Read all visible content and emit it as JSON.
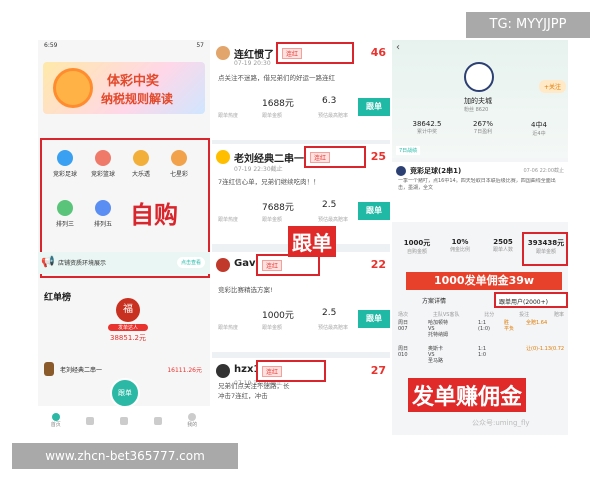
{
  "watermark_tg": "TG: MYYJJPP",
  "watermark_site": "www.zhcn-bet365777.com",
  "left": {
    "time": "6:59",
    "battery": "57",
    "banner_line1": "体彩中奖",
    "banner_line2": "纳税规则解读",
    "categories": [
      {
        "label": "竞彩足球",
        "color": "#3aa0f2"
      },
      {
        "label": "竞彩篮球",
        "color": "#f07a6a"
      },
      {
        "label": "大乐透",
        "color": "#f2b03a"
      },
      {
        "label": "七星彩",
        "color": "#f2a24a"
      },
      {
        "label": "排列三",
        "color": "#5ac47a"
      },
      {
        "label": "排列五",
        "color": "#5a8ef2"
      }
    ],
    "self_buy_caption": "自购",
    "shop_line": "店铺资质环境展示",
    "shop_button": "点击查看",
    "ranking_title": "红单榜",
    "rank_badge": "福",
    "rank_tag": "发单达人",
    "rank_amount": "38851.2元",
    "row_name": "老刘经典二串一",
    "row_amount": "16111.26元",
    "fab": "跟单",
    "nav": [
      "首页",
      "",
      "",
      "",
      "我的"
    ]
  },
  "middle": {
    "posts": [
      {
        "title": "连红惯了",
        "tag": "连红",
        "date": "07-19 20:30",
        "text": "点关注不迷路，借兄弟们的好运一路连红",
        "amount": "1688元",
        "amount_label": "跟单金额",
        "odds": "6.3",
        "odds_label": "预估最高赔率",
        "heat": "跟单热度",
        "follow": "跟单",
        "right_num": "46"
      },
      {
        "title": "老刘经典二串一",
        "tag": "连红",
        "date": "07-19 22:30截止",
        "text": "7连红信心单，兄弟们继续吃肉！！",
        "amount": "7688元",
        "amount_label": "跟单金额",
        "odds": "2.5",
        "odds_label": "预估最高赔率",
        "heat": "跟单热度",
        "follow": "跟单",
        "right_num": "25"
      },
      {
        "title": "Gaven",
        "tag": "连红",
        "date": "",
        "text": "竞彩比赛精选方案!",
        "amount": "1000元",
        "amount_label": "跟单金额",
        "odds": "2.5",
        "odds_label": "预估最高赔率",
        "heat": "跟单热度",
        "follow": "跟单",
        "right_num": "22"
      },
      {
        "title": "hzx123",
        "tag": "连红",
        "date": "07-19 22:30截止",
        "text": "冲击7连红，冲击",
        "amount": "",
        "amount_label": "",
        "odds": "",
        "odds_label": "",
        "heat": "",
        "follow": "",
        "right_num": "27"
      }
    ],
    "intro_line": "兄弟们点关注不迷路，长",
    "follow_caption": "跟单"
  },
  "right": {
    "club": "加的夫城",
    "fans": "粉丝 8620",
    "follow_btn": "+关注",
    "stats": [
      {
        "v": "38642.5",
        "l": "累计中奖"
      },
      {
        "v": "267%",
        "l": "7日盈利"
      },
      {
        "v": "4中4",
        "l": "近4中"
      }
    ],
    "tab": "7日战绩",
    "plan_title": "竞彩足球(2串1)",
    "plan_date": "07-06 22:00截止",
    "plan_text": "一季一个赌叮，点16中14。四天轻取日本联后级比赛，四国曲线全面出击，墨湖，全文",
    "numbers": [
      {
        "v": "1000元",
        "l": "自购金额"
      },
      {
        "v": "10%",
        "l": "佣金比例"
      },
      {
        "v": "2505",
        "l": "跟单人数"
      },
      {
        "v": "393438元",
        "l": "跟单金额"
      }
    ],
    "banner_commission": "1000发单佣金39w",
    "scheme_detail": "方案详情",
    "followers": "跟单用户(2000+)",
    "table_head": [
      "场次",
      "主队VS客队",
      "比分",
      "投注",
      "赔率"
    ],
    "table_rows": [
      [
        "周日\n007",
        "哈加顿特\nVS\n托特纳姆",
        "1:1\n(1:0)",
        "胜\n平负",
        "全赔1.64"
      ],
      [
        "周日\n010",
        "奥斯卡\nVS\n圣马路",
        "1:1\n1:0",
        "",
        "让(0)-1.13(0.72"
      ]
    ],
    "bottom_caption": "发单赚佣金",
    "faint": "公众号:uming_fly"
  }
}
